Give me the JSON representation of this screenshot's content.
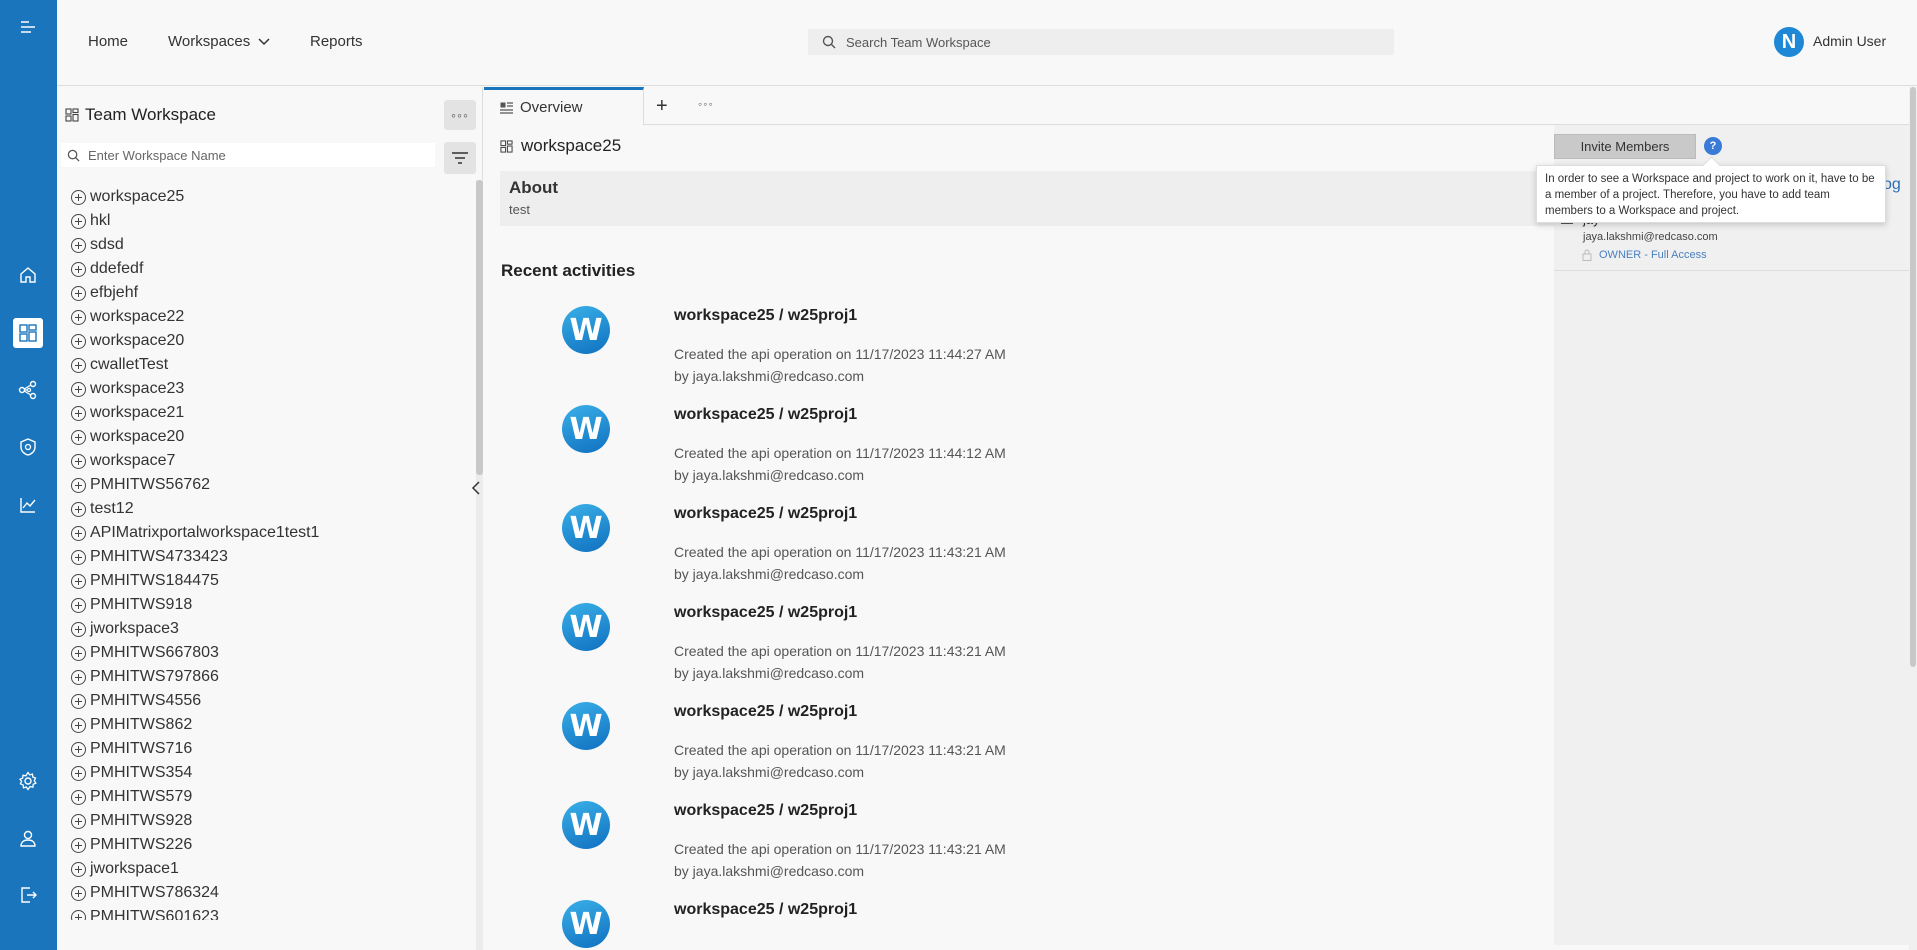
{
  "nav": {
    "home": "Home",
    "workspaces": "Workspaces",
    "reports": "Reports"
  },
  "search": {
    "placeholder": "Search Team Workspace"
  },
  "user": {
    "initial": "N",
    "name": "Admin User"
  },
  "sidebar": {
    "title": "Team Workspace",
    "search_placeholder": "Enter Workspace Name",
    "items": [
      "workspace25",
      "hkl",
      "sdsd",
      "ddefedf",
      "efbjehf",
      "workspace22",
      "workspace20",
      "cwalletTest",
      "workspace23",
      "workspace21",
      "workspace20",
      "workspace7",
      "PMHITWS56762",
      "test12",
      "APIMatrixportalworkspace1test1",
      "PMHITWS4733423",
      "PMHITWS184475",
      "PMHITWS918",
      "jworkspace3",
      "PMHITWS667803",
      "PMHITWS797866",
      "PMHITWS4556",
      "PMHITWS862",
      "PMHITWS716",
      "PMHITWS354",
      "PMHITWS579",
      "PMHITWS928",
      "PMHITWS226",
      "jworkspace1",
      "PMHITWS786324",
      "PMHITWS601623"
    ]
  },
  "tabs": {
    "overview": "Overview",
    "add": "+",
    "more": "◦◦◦"
  },
  "workspace": {
    "name": "workspace25",
    "about_title": "About",
    "about_text": "test"
  },
  "recent": {
    "title": "Recent activities",
    "logo_letter": "W",
    "activities": [
      {
        "title": "workspace25 / w25proj1",
        "desc": "Created the api operation on 11/17/2023 11:44:27 AM",
        "by": "by jaya.lakshmi@redcaso.com"
      },
      {
        "title": "workspace25 / w25proj1",
        "desc": "Created the api operation on 11/17/2023 11:44:12 AM",
        "by": "by jaya.lakshmi@redcaso.com"
      },
      {
        "title": "workspace25 / w25proj1",
        "desc": "Created the api operation on 11/17/2023 11:43:21 AM",
        "by": "by jaya.lakshmi@redcaso.com"
      },
      {
        "title": "workspace25 / w25proj1",
        "desc": "Created the api operation on 11/17/2023 11:43:21 AM",
        "by": "by jaya.lakshmi@redcaso.com"
      },
      {
        "title": "workspace25 / w25proj1",
        "desc": "Created the api operation on 11/17/2023 11:43:21 AM",
        "by": "by jaya.lakshmi@redcaso.com"
      },
      {
        "title": "workspace25 / w25proj1",
        "desc": "Created the api operation on 11/17/2023 11:43:21 AM",
        "by": "by jaya.lakshmi@redcaso.com"
      },
      {
        "title": "workspace25 / w25proj1",
        "desc": "",
        "by": ""
      }
    ]
  },
  "members": {
    "invite_label": "Invite Members",
    "help_label": "?",
    "tooltip": "In order to see a Workspace and project to work on it, have to be a member of a project. Therefore, you have to add team members to a Workspace and project.",
    "name_fragment": "jay",
    "email": "jaya.lakshmi@redcaso.com",
    "role": "OWNER - Full Access",
    "log_fragment": "og"
  },
  "icons": {
    "rail": [
      "menu-icon",
      "home-icon",
      "workspace-icon",
      "share-nodes-icon",
      "shield-icon",
      "chart-icon",
      "settings-icon",
      "user-icon",
      "logout-icon"
    ]
  },
  "colors": {
    "brand": "#1b75bc",
    "link": "#4a7fc1",
    "help": "#3a7bd5"
  }
}
